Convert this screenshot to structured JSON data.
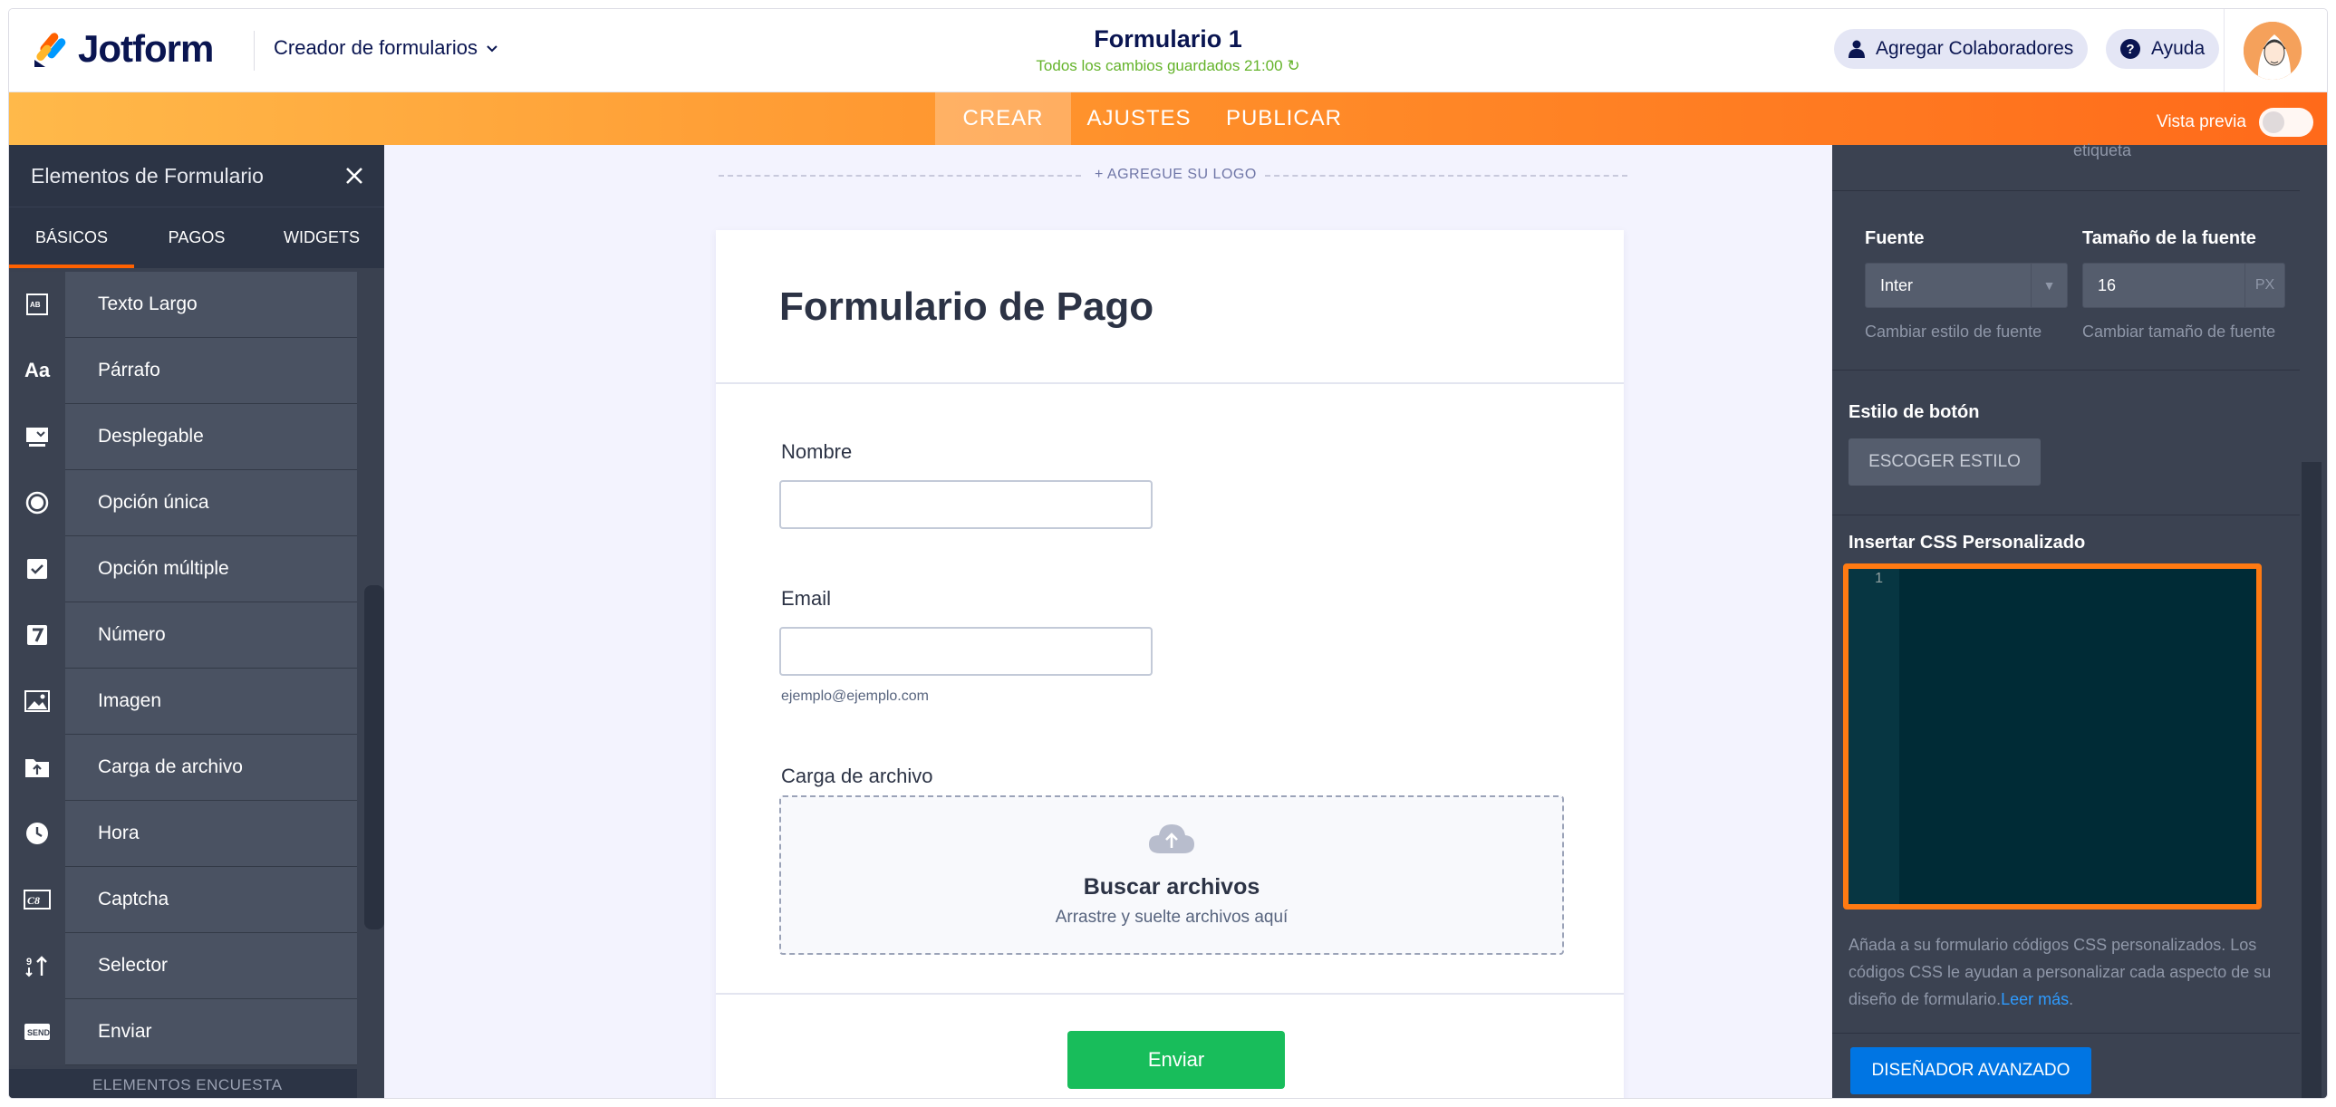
{
  "header": {
    "brand": "Jotform",
    "builder_label": "Creador de formularios",
    "form_title": "Formulario 1",
    "saved_status": "Todos los cambios guardados 21:00",
    "collaborators_label": "Agregar Colaboradores",
    "help_label": "Ayuda",
    "brand_colors": [
      "#ff6100",
      "#0099ff",
      "#ffb629",
      "#0a1551"
    ]
  },
  "nav": {
    "tabs": [
      {
        "label": "CREAR",
        "active": true
      },
      {
        "label": "AJUSTES",
        "active": false
      },
      {
        "label": "PUBLICAR",
        "active": false
      }
    ],
    "preview_label": "Vista previa",
    "preview_enabled": false
  },
  "left_panel": {
    "title": "Elementos de Formulario",
    "tabs": [
      {
        "label": "BÁSICOS",
        "active": true
      },
      {
        "label": "PAGOS",
        "active": false
      },
      {
        "label": "WIDGETS",
        "active": false
      }
    ],
    "items": [
      {
        "label": "Texto Largo",
        "icon": "textarea-icon"
      },
      {
        "label": "Párrafo",
        "icon": "paragraph-icon"
      },
      {
        "label": "Desplegable",
        "icon": "dropdown-icon"
      },
      {
        "label": "Opción única",
        "icon": "radio-icon"
      },
      {
        "label": "Opción múltiple",
        "icon": "checkbox-icon"
      },
      {
        "label": "Número",
        "icon": "number-icon"
      },
      {
        "label": "Imagen",
        "icon": "image-icon"
      },
      {
        "label": "Carga de archivo",
        "icon": "file-upload-icon"
      },
      {
        "label": "Hora",
        "icon": "clock-icon"
      },
      {
        "label": "Captcha",
        "icon": "captcha-icon"
      },
      {
        "label": "Selector",
        "icon": "spinner-icon"
      },
      {
        "label": "Enviar",
        "icon": "submit-icon"
      }
    ],
    "section_label": "ELEMENTOS ENCUESTA"
  },
  "canvas": {
    "add_logo": "+ AGREGUE SU LOGO",
    "form_heading": "Formulario de Pago",
    "fields": {
      "name_label": "Nombre",
      "email_label": "Email",
      "email_sublabel": "ejemplo@ejemplo.com",
      "upload_label": "Carga de archivo"
    },
    "upload": {
      "title": "Buscar archivos",
      "subtitle": "Arrastre y suelte archivos aquí"
    },
    "submit_label": "Enviar"
  },
  "right_panel": {
    "top_label_fragment": "etiqueta",
    "font_label": "Fuente",
    "font_value": "Inter",
    "font_help": "Cambiar estilo de fuente",
    "font_size_label": "Tamaño de la fuente",
    "font_size_value": "16",
    "font_size_unit": "PX",
    "font_size_help": "Cambiar tamaño de fuente",
    "button_style_label": "Estilo de botón",
    "choose_style_label": "ESCOGER ESTILO",
    "css_label": "Insertar CSS Personalizado",
    "css_line_number": "1",
    "css_help": "Añada a su formulario códigos CSS personalizados. Los códigos CSS le ayudan a personalizar cada aspecto de su diseño de formulario.",
    "read_more": "Leer más",
    "advanced_designer_label": "DISEÑADOR AVANZADO"
  }
}
